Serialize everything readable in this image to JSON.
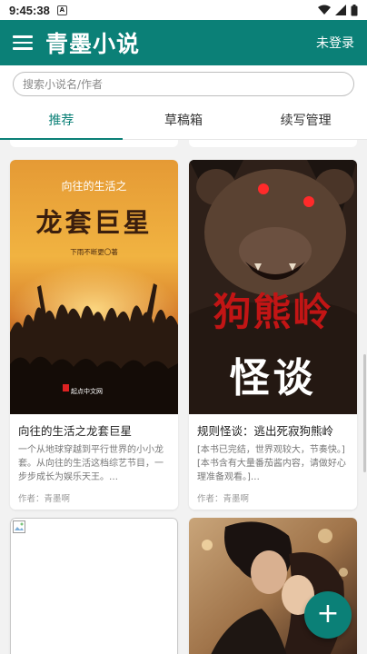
{
  "status": {
    "time": "9:45:38",
    "notif_glyph": "A"
  },
  "appbar": {
    "title": "青墨小说",
    "login": "未登录"
  },
  "search": {
    "placeholder": "搜索小说名/作者"
  },
  "tabs": [
    {
      "label": "推荐"
    },
    {
      "label": "草稿箱"
    },
    {
      "label": "续写管理"
    }
  ],
  "books": [
    {
      "title": "向往的生活之龙套巨星",
      "desc": "一个从地球穿越到平行世界的小小龙套。从向往的生活这档综艺节目，一步步成长为娱乐天王。…",
      "author": "作者：青墨啊",
      "cover": {
        "top_title": "向往的生活之",
        "big_title": "龙套巨星",
        "sub": "下雨不断更〇著",
        "brand": "起点中文网"
      }
    },
    {
      "title": "规则怪谈：逃出死寂狗熊岭",
      "desc": "[本书已完结，世界观较大，节奏快。][本书含有大量番茄酱内容，请做好心理准备观看。]…",
      "author": "作者：青墨啊",
      "cover": {
        "red_title": "狗熊岭",
        "white_title": "怪谈"
      }
    }
  ],
  "fab": {
    "label": "+"
  },
  "colors": {
    "primary": "#0b8077",
    "background": "#f2f2f2"
  }
}
